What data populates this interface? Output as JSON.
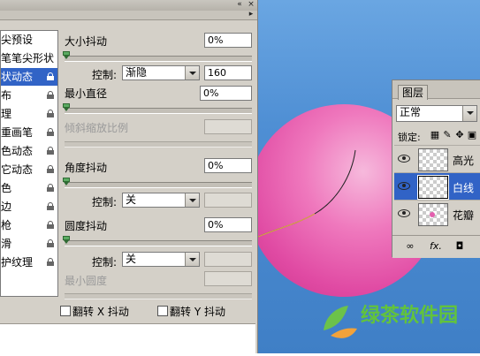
{
  "brush_panel": {
    "left_list": [
      {
        "label": "笔尖预设",
        "selected": false,
        "locked": false
      },
      {
        "label": "画笔笔尖形状",
        "selected": false,
        "locked": false
      },
      {
        "label": "形状动态",
        "selected": true,
        "locked": true
      },
      {
        "label": "散布",
        "selected": false,
        "locked": true
      },
      {
        "label": "纹理",
        "selected": false,
        "locked": true
      },
      {
        "label": "双重画笔",
        "selected": false,
        "locked": true
      },
      {
        "label": "颜色动态",
        "selected": false,
        "locked": true
      },
      {
        "label": "其它动态",
        "selected": false,
        "locked": true
      },
      {
        "label": "杂色",
        "selected": false,
        "locked": true
      },
      {
        "label": "湿边",
        "selected": false,
        "locked": true
      },
      {
        "label": "喷枪",
        "selected": false,
        "locked": true
      },
      {
        "label": "平滑",
        "selected": false,
        "locked": true
      },
      {
        "label": "保护纹理",
        "selected": false,
        "locked": true
      }
    ],
    "size_jitter": {
      "label": "大小抖动",
      "value": "0%",
      "slider": 0
    },
    "size_control": {
      "label": "控制:",
      "value": "渐隐",
      "steps": "160"
    },
    "min_diameter": {
      "label": "最小直径",
      "value": "0%",
      "slider": 0
    },
    "tilt_scale": {
      "label": "倾斜缩放比例",
      "value": ""
    },
    "angle_jitter": {
      "label": "角度抖动",
      "value": "0%",
      "slider": 0
    },
    "angle_control": {
      "label": "控制:",
      "value": "关",
      "extra": ""
    },
    "roundness_jitter": {
      "label": "圆度抖动",
      "value": "0%",
      "slider": 0
    },
    "roundness_control": {
      "label": "控制:",
      "value": "关",
      "extra": ""
    },
    "min_roundness": {
      "label": "最小圆度",
      "value": ""
    },
    "flip_x": {
      "label": "翻转 X 抖动",
      "checked": false
    },
    "flip_y": {
      "label": "翻转 Y 抖动",
      "checked": false
    }
  },
  "layers_panel": {
    "tab": "图层",
    "blend_mode": "正常",
    "lock_label": "锁定:",
    "layers": [
      {
        "name": "高光",
        "selected": false,
        "visible": true
      },
      {
        "name": "白线",
        "selected": true,
        "visible": true
      },
      {
        "name": "花瓣",
        "selected": false,
        "visible": true
      }
    ],
    "footer_fx": "fx."
  },
  "watermark": {
    "text": "绿茶软件园"
  },
  "colors": {
    "selection": "#3163c6",
    "sphere": "#ef78bd",
    "canvas": "#4f8fd4",
    "panel": "#d4d0c8"
  }
}
